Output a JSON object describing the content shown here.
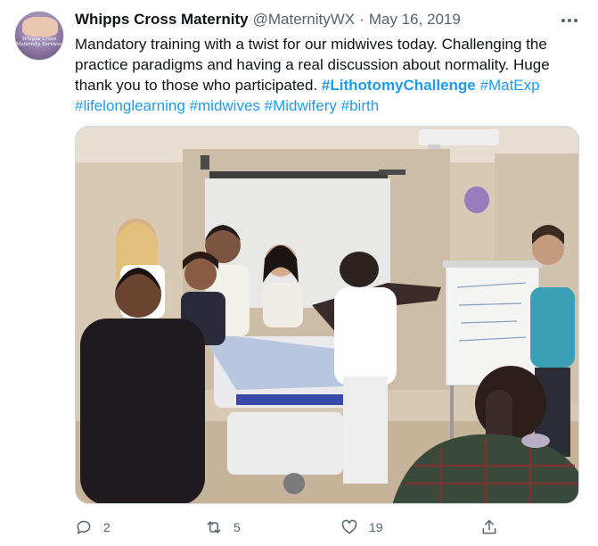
{
  "tweet": {
    "display_name": "Whipps Cross Maternity",
    "handle": "@MaternityWX",
    "separator": "·",
    "date": "May 16, 2019",
    "avatar_text": "Whipps Cross Maternity Services",
    "text_plain": "Mandatory training with a twist for our midwives today. Challenging the practice paradigms and having a real discussion about normality. Huge thank you to those who participated. ",
    "hashtags": [
      "#LithotomyChallenge",
      "#MatExp",
      "#lifelonglearning",
      "#midwives",
      "#Midwifery",
      "#birth"
    ]
  },
  "actions": {
    "reply_count": "2",
    "retweet_count": "5",
    "like_count": "19"
  },
  "icons": {
    "more": "more-dots-icon",
    "reply": "reply-icon",
    "retweet": "retweet-icon",
    "like": "heart-icon",
    "share": "share-icon"
  },
  "colors": {
    "link": "#1d9bf0",
    "text": "#0f1419",
    "secondary": "#536471"
  }
}
